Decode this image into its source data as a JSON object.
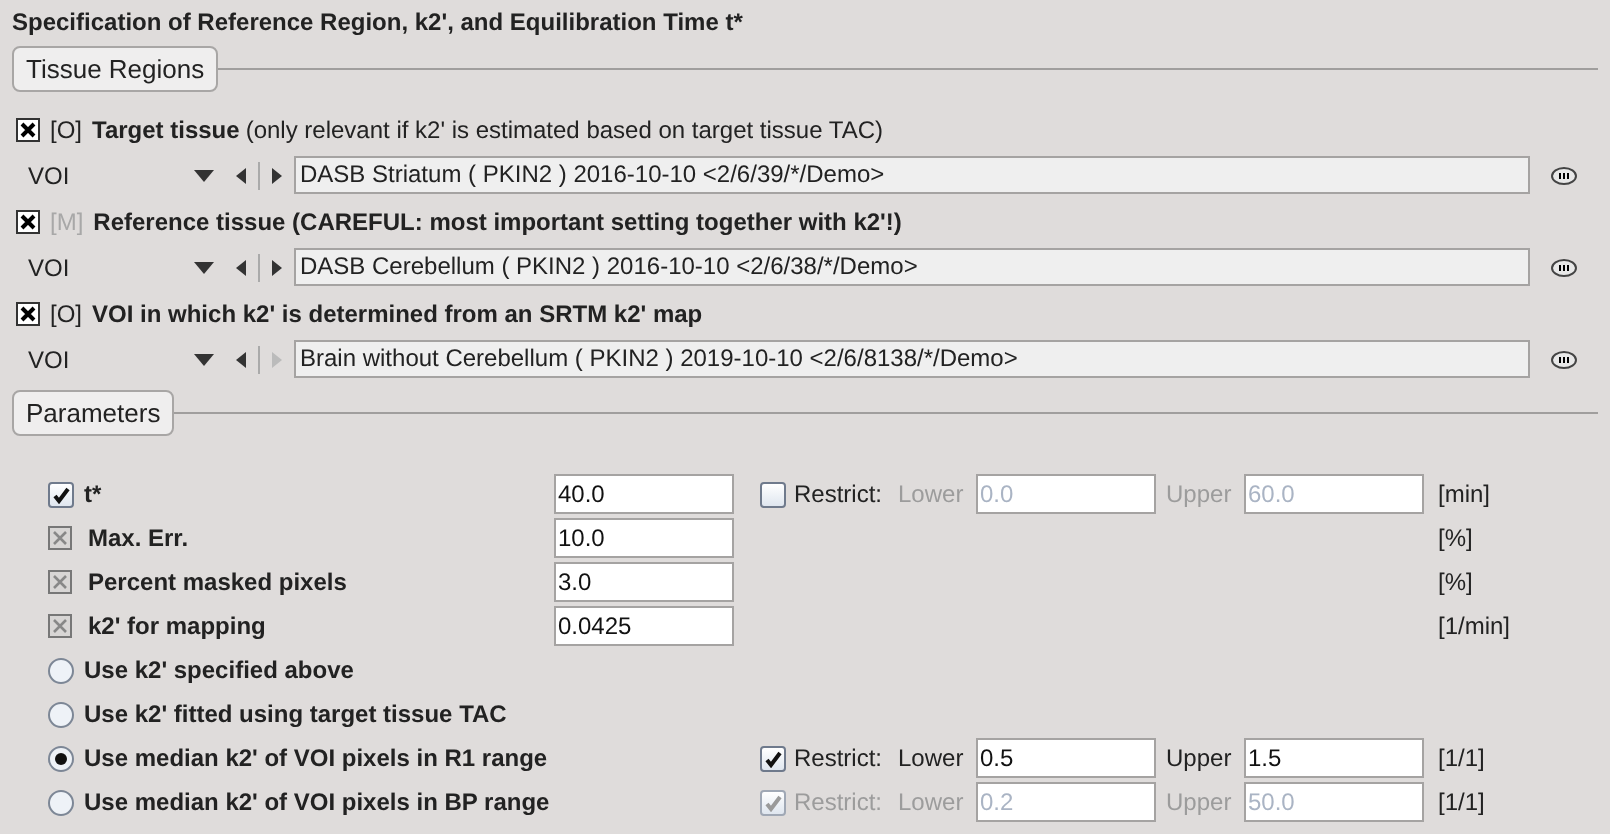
{
  "title": "Specification of Reference Region, k2', and Equilibration Time t*",
  "tissue_regions": {
    "header": "Tissue Regions",
    "regions": [
      {
        "checked": true,
        "tag": "[O]",
        "tag_disabled": false,
        "label": "Target tissue",
        "note": "(only relevant if k2' is estimated based on target tissue TAC)",
        "selector": "VOI",
        "voi": "DASB Striatum ( PKIN2 ) 2016-10-10 <2/6/39/*/Demo>",
        "next_disabled": false
      },
      {
        "checked": true,
        "tag": "[M]",
        "tag_disabled": true,
        "label": "Reference tissue (CAREFUL: most important setting together with k2'!)",
        "selector": "VOI",
        "voi": "DASB Cerebellum ( PKIN2 ) 2016-10-10 <2/6/38/*/Demo>",
        "next_disabled": false
      },
      {
        "checked": true,
        "tag": "[O]",
        "tag_disabled": false,
        "label": "VOI in which k2' is determined from an SRTM k2' map",
        "selector": "VOI",
        "voi": "Brain without Cerebellum ( PKIN2 ) 2019-10-10 <2/6/8138/*/Demo>",
        "next_disabled": true
      }
    ]
  },
  "parameters": {
    "header": "Parameters",
    "rows": [
      {
        "kind": "checkbox",
        "checked": true,
        "disabled": false,
        "label": "t*",
        "value": "40.0",
        "restrict": {
          "checked": false,
          "disabled": false,
          "label": "Restrict:",
          "lower_label": "Lower",
          "lower": "0.0",
          "upper_label": "Upper",
          "upper": "60.0"
        },
        "unit": "[min]"
      },
      {
        "kind": "checkbox",
        "checked": true,
        "disabled": true,
        "label": "Max. Err.",
        "value": "10.0",
        "unit": "[%]"
      },
      {
        "kind": "checkbox",
        "checked": true,
        "disabled": true,
        "label": "Percent masked pixels",
        "value": "3.0",
        "unit": "[%]"
      },
      {
        "kind": "checkbox",
        "checked": true,
        "disabled": true,
        "label": "k2' for mapping",
        "value": "0.0425",
        "unit": "[1/min]"
      },
      {
        "kind": "radio",
        "selected": false,
        "label": "Use k2' specified above"
      },
      {
        "kind": "radio",
        "selected": false,
        "label": "Use k2' fitted using target tissue TAC"
      },
      {
        "kind": "radio",
        "selected": true,
        "label": "Use median k2' of VOI pixels in R1 range",
        "restrict": {
          "checked": true,
          "disabled": false,
          "label": "Restrict:",
          "lower_label": "Lower",
          "lower": "0.5",
          "upper_label": "Upper",
          "upper": "1.5"
        },
        "unit": "[1/1]"
      },
      {
        "kind": "radio",
        "selected": false,
        "label": "Use median k2' of VOI pixels in BP range",
        "restrict": {
          "checked": true,
          "disabled": true,
          "label": "Restrict:",
          "lower_label": "Lower",
          "lower": "0.2",
          "upper_label": "Upper",
          "upper": "50.0"
        },
        "unit": "[1/1]"
      }
    ]
  }
}
